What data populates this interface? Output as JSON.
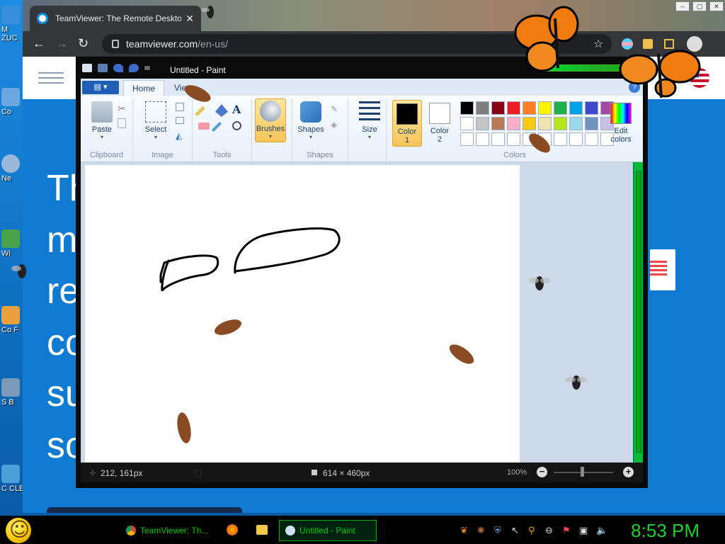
{
  "desktop": {
    "icons": [
      {
        "label": "M ZUC",
        "color": "#3a8fdc"
      },
      {
        "label": "Co",
        "color": "#6aa6e0"
      },
      {
        "label": "Ne",
        "color": "#9ab7d8"
      },
      {
        "label": "Wi",
        "color": "#4aa34a"
      },
      {
        "label": "Co F",
        "color": "#e8a040"
      },
      {
        "label": "S B",
        "color": "#7a9ab8"
      },
      {
        "label": "C CLE",
        "color": "#4aa0d8"
      }
    ]
  },
  "browser": {
    "tab_title": "TeamViewer: The Remote Deskto",
    "tab_close": "✕",
    "url_host": "teamviewer.com",
    "url_path": "/en-us/",
    "nav_back": "←",
    "nav_forward": "→",
    "nav_reload": "↻",
    "star": "☆",
    "window_buttons": [
      "‒",
      "▢",
      "✕"
    ]
  },
  "webpage": {
    "hero_lines": [
      "Th",
      "m",
      "re",
      "co",
      "su",
      "so"
    ]
  },
  "paint": {
    "title": "Untitled - Paint",
    "ribbon_tabs": {
      "file": "▤ ▾",
      "home": "Home",
      "view": "View"
    },
    "help": "?",
    "groups": {
      "clipboard": "Clipboard",
      "image": "Image",
      "tools": "Tools",
      "shapes": "Shapes",
      "colors": "Colors"
    },
    "buttons": {
      "paste": "Paste",
      "select": "Select",
      "brushes": "Brushes",
      "shapes": "Shapes",
      "size": "Size",
      "color1_line1": "Color",
      "color1_line2": "1",
      "color2_line1": "Color",
      "color2_line2": "2",
      "edit_colors_line1": "Edit",
      "edit_colors_line2": "colors",
      "dropdown": "▾"
    },
    "palette_row1": [
      "#000000",
      "#7f7f7f",
      "#880015",
      "#ed1c24",
      "#ff7f27",
      "#fff200",
      "#22b14c",
      "#00a2e8",
      "#3f48cc",
      "#a349a4"
    ],
    "palette_row2": [
      "#ffffff",
      "#c3c3c3",
      "#b97a57",
      "#ffaec9",
      "#ffc90e",
      "#efe4b0",
      "#b5e61d",
      "#99d9ea",
      "#7092be",
      "#c8bfe7"
    ],
    "status": {
      "cursor_pos": "212, 161px",
      "canvas_size": "614 × 460px",
      "zoom": "100%",
      "zoom_out": "−",
      "zoom_in": "+"
    }
  },
  "taskbar": {
    "tasks": [
      {
        "label": "TeamViewer: Th...",
        "color": "#db4437"
      },
      {
        "label": "Untitled - Paint",
        "color": "#5a9ad8"
      }
    ],
    "clock": "8:53 PM"
  }
}
